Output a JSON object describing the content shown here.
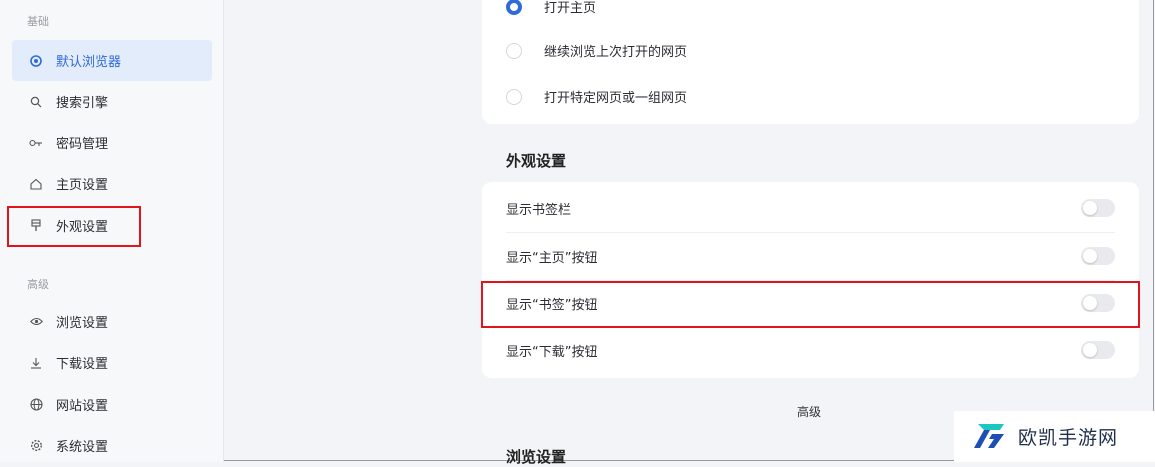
{
  "sidebar": {
    "section_basic": "基础",
    "section_advanced": "高级",
    "items": [
      {
        "label": "默认浏览器",
        "icon": "globe-icon",
        "active": true
      },
      {
        "label": "搜索引擎",
        "icon": "search-icon"
      },
      {
        "label": "密码管理",
        "icon": "key-icon"
      },
      {
        "label": "主页设置",
        "icon": "home-icon"
      },
      {
        "label": "外观设置",
        "icon": "brush-icon"
      },
      {
        "label": "浏览设置",
        "icon": "eye-icon"
      },
      {
        "label": "下载设置",
        "icon": "download-icon"
      },
      {
        "label": "网站设置",
        "icon": "globe-icon"
      },
      {
        "label": "系统设置",
        "icon": "gear-icon"
      }
    ]
  },
  "startup": {
    "options": [
      {
        "label": "打开主页",
        "checked": true
      },
      {
        "label": "继续浏览上次打开的网页",
        "checked": false
      },
      {
        "label": "打开特定网页或一组网页",
        "checked": false
      }
    ]
  },
  "appearance": {
    "title": "外观设置",
    "rows": [
      {
        "label": "显示书签栏",
        "on": false
      },
      {
        "label": "显示“主页”按钮",
        "on": false
      },
      {
        "label": "显示“书签”按钮",
        "on": false
      },
      {
        "label": "显示“下载”按钮",
        "on": false
      }
    ]
  },
  "advanced_label": "高级",
  "browse_title": "浏览设置",
  "watermark": {
    "text": "欧凯手游网"
  },
  "colors": {
    "accent": "#2f6ad9",
    "highlight": "#e0141a"
  }
}
